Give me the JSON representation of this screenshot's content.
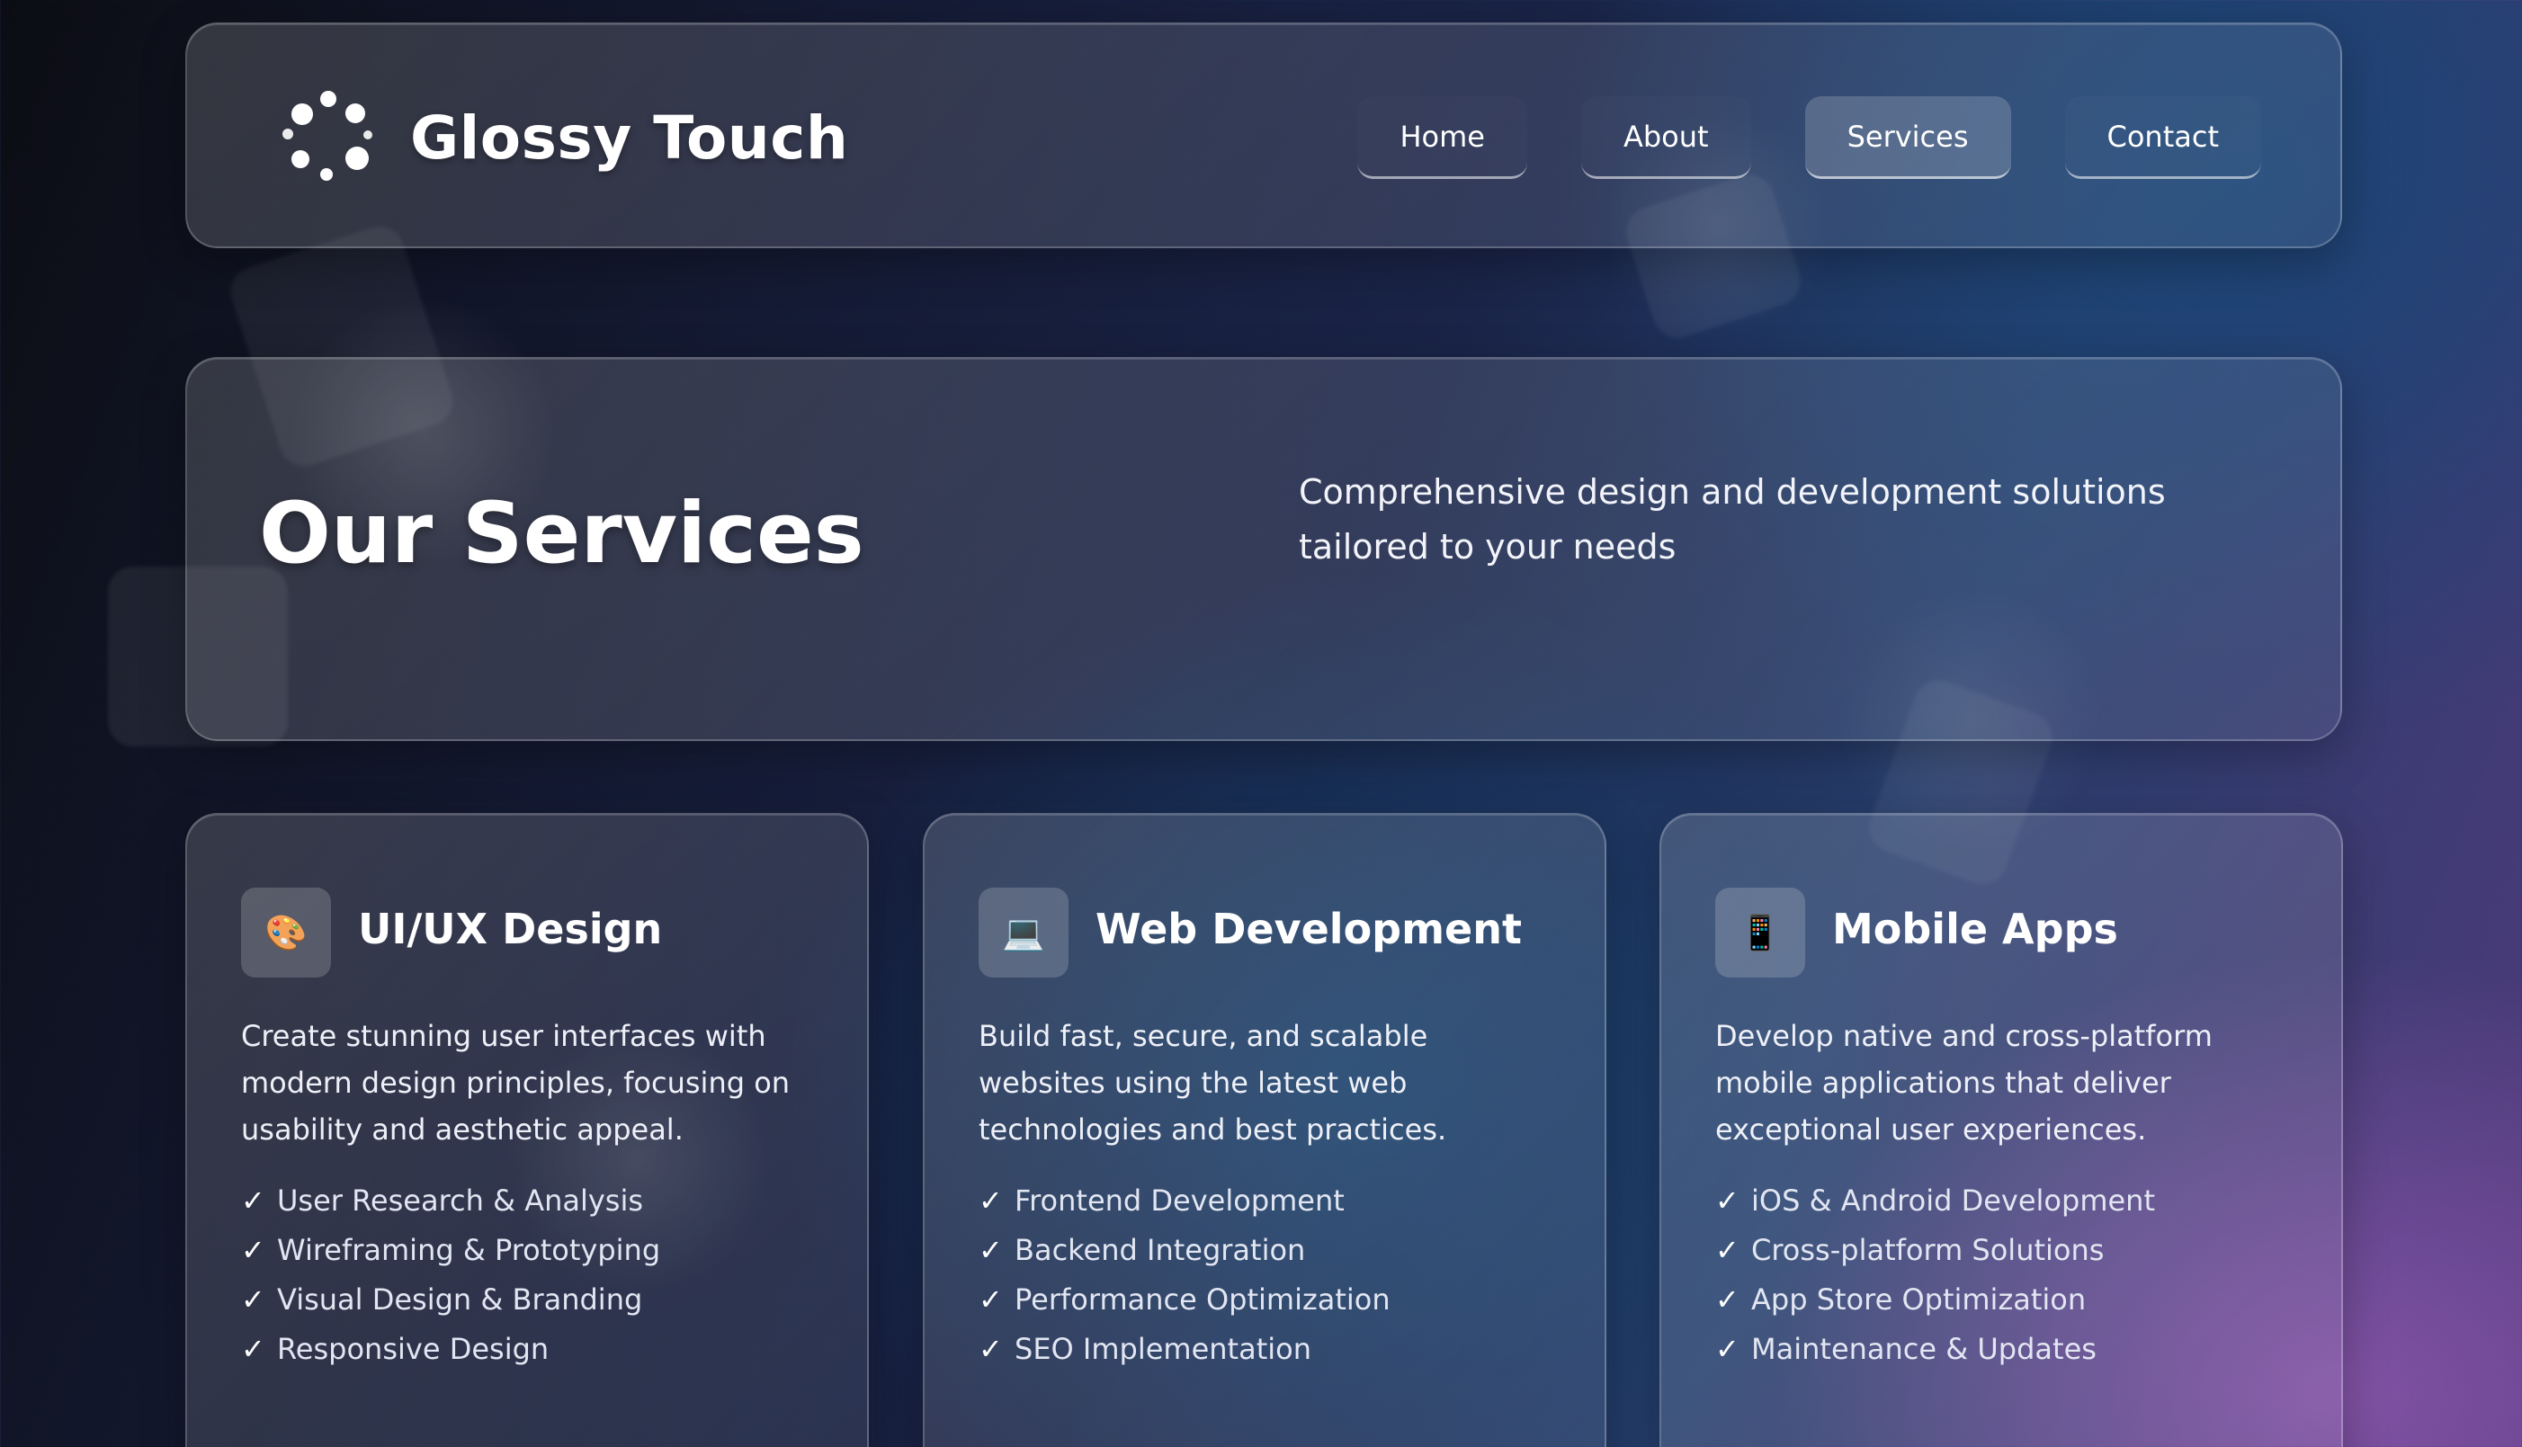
{
  "brand": {
    "name": "Glossy Touch",
    "logo_icon": "dots-spinner-icon"
  },
  "nav": {
    "items": [
      {
        "label": "Home",
        "active": false
      },
      {
        "label": "About",
        "active": false
      },
      {
        "label": "Services",
        "active": true
      },
      {
        "label": "Contact",
        "active": false
      }
    ]
  },
  "hero": {
    "title": "Our Services",
    "subtitle": "Comprehensive design and development solutions tailored to your needs"
  },
  "services": [
    {
      "icon": "🎨",
      "icon_name": "palette-icon",
      "title": "UI/UX Design",
      "description": "Create stunning user interfaces with modern design principles, focusing on usability and aesthetic appeal.",
      "features": [
        "User Research & Analysis",
        "Wireframing & Prototyping",
        "Visual Design & Branding",
        "Responsive Design"
      ]
    },
    {
      "icon": "💻",
      "icon_name": "laptop-icon",
      "title": "Web Development",
      "description": "Build fast, secure, and scalable websites using the latest web technologies and best practices.",
      "features": [
        "Frontend Development",
        "Backend Integration",
        "Performance Optimization",
        "SEO Implementation"
      ]
    },
    {
      "icon": "📱",
      "icon_name": "mobile-phone-icon",
      "title": "Mobile Apps",
      "description": "Develop native and cross-platform mobile applications that deliver exceptional user experiences.",
      "features": [
        "iOS & Android Development",
        "Cross-platform Solutions",
        "App Store Optimization",
        "Maintenance & Updates"
      ]
    }
  ],
  "check_glyph": "✓",
  "colors": {
    "background_start": "#0c0d14",
    "background_end": "#4f3a7a",
    "text": "#ffffff"
  }
}
